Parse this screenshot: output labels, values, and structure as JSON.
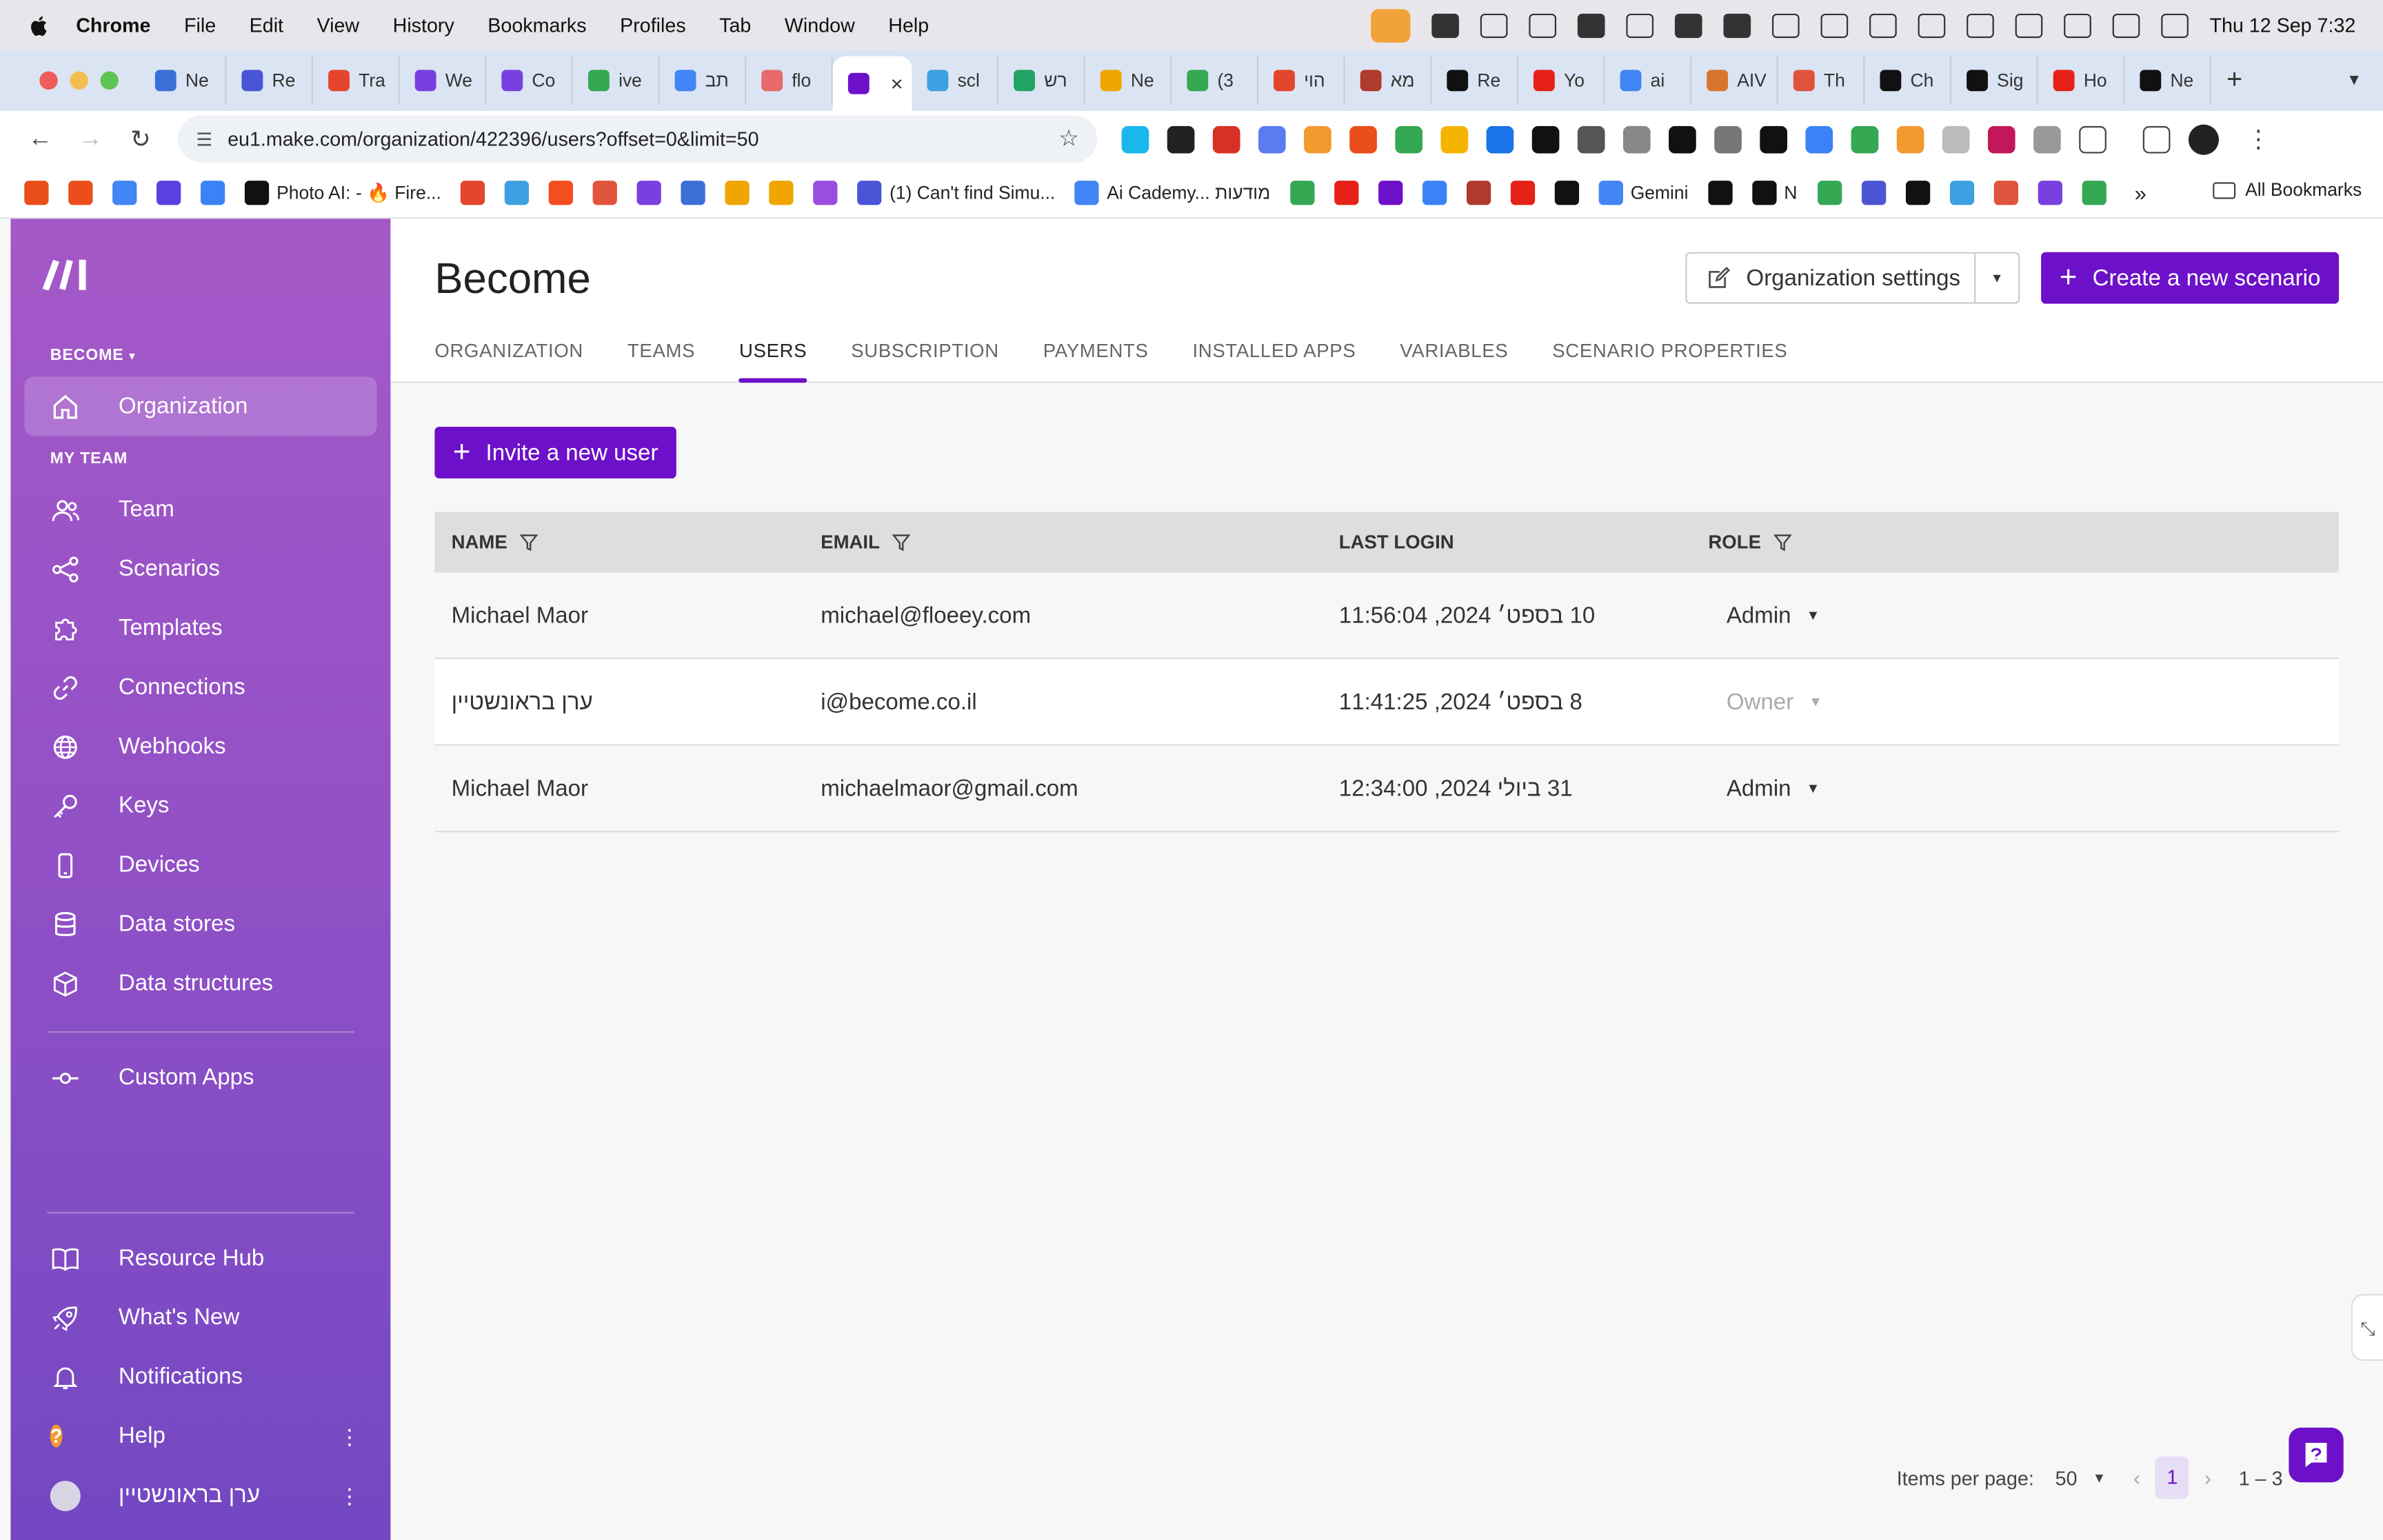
{
  "os_menubar": {
    "app": "Chrome",
    "items": [
      "File",
      "Edit",
      "View",
      "History",
      "Bookmarks",
      "Profiles",
      "Tab",
      "Window",
      "Help"
    ],
    "clock": "Thu 12 Sep  7:32"
  },
  "browser": {
    "tabs": [
      {
        "label": "Ne",
        "color": "#3b6fd8"
      },
      {
        "label": "Re",
        "color": "#4a55d6"
      },
      {
        "label": "Tra",
        "color": "#e3462c"
      },
      {
        "label": "We",
        "color": "#7a3fe0"
      },
      {
        "label": "Co",
        "color": "#7a3fe0"
      },
      {
        "label": "ive",
        "color": "#34a853"
      },
      {
        "label": "תב",
        "color": "#4285f4"
      },
      {
        "label": "flo",
        "color": "#e86a6a"
      },
      {
        "label": "",
        "color": "#6d10c9",
        "active": true
      },
      {
        "label": "scl",
        "color": "#3ea0e0"
      },
      {
        "label": "רש",
        "color": "#21a464"
      },
      {
        "label": "Ne",
        "color": "#f0a500"
      },
      {
        "label": "(3",
        "color": "#34a853"
      },
      {
        "label": "הוי",
        "color": "#e3462c"
      },
      {
        "label": "מא",
        "color": "#b03a2e"
      },
      {
        "label": "Re",
        "color": "#111111"
      },
      {
        "label": "Yo",
        "color": "#e62117"
      },
      {
        "label": "ai",
        "color": "#4285f4"
      },
      {
        "label": "AIV",
        "color": "#d9752b"
      },
      {
        "label": "Th",
        "color": "#e0533d"
      },
      {
        "label": "Ch",
        "color": "#111111"
      },
      {
        "label": "Sig",
        "color": "#111111"
      },
      {
        "label": "Ho",
        "color": "#e62117"
      },
      {
        "label": "Ne",
        "color": "#111111"
      }
    ],
    "url": "eu1.make.com/organization/422396/users?offset=0&limit=50",
    "bookmarks": [
      {
        "label": "",
        "color": "#e94e1b"
      },
      {
        "label": "",
        "color": "#e94e1b"
      },
      {
        "label": "",
        "color": "#4285f4"
      },
      {
        "label": "",
        "color": "#5b3fe0"
      },
      {
        "label": "",
        "color": "#3b82f6"
      },
      {
        "label": "Photo AI: - 🔥 Fire...",
        "color": "#111111"
      },
      {
        "label": "",
        "color": "#e3462c"
      },
      {
        "label": "",
        "color": "#3ea0e0"
      },
      {
        "label": "",
        "color": "#f24e1e"
      },
      {
        "label": "",
        "color": "#e0533d"
      },
      {
        "label": "",
        "color": "#7a3fe0"
      },
      {
        "label": "",
        "color": "#3b6fd8"
      },
      {
        "label": "",
        "color": "#f0a500"
      },
      {
        "label": "",
        "color": "#f0a500"
      },
      {
        "label": "",
        "color": "#9b4de0"
      },
      {
        "label": "(1) Can't find Simu...",
        "color": "#4a55d6"
      },
      {
        "label": "Ai Cademy... מודעות",
        "color": "#4285f4"
      },
      {
        "label": "",
        "color": "#34a853"
      },
      {
        "label": "",
        "color": "#e62117"
      },
      {
        "label": "",
        "color": "#6d10c9"
      },
      {
        "label": "",
        "color": "#3b82f6"
      },
      {
        "label": "",
        "color": "#b03a2e"
      },
      {
        "label": "",
        "color": "#e62117"
      },
      {
        "label": "",
        "color": "#111111"
      },
      {
        "label": "Gemini",
        "color": "#4285f4"
      },
      {
        "label": "",
        "color": "#111111"
      },
      {
        "label": "N",
        "color": "#111111"
      },
      {
        "label": "",
        "color": "#34a853"
      },
      {
        "label": "",
        "color": "#4a55d6"
      },
      {
        "label": "",
        "color": "#111111"
      },
      {
        "label": "",
        "color": "#3ea0e0"
      },
      {
        "label": "",
        "color": "#e0533d"
      },
      {
        "label": "",
        "color": "#7a3fe0"
      },
      {
        "label": "",
        "color": "#34a853"
      }
    ],
    "all_bookmarks": "All Bookmarks"
  },
  "sidebar": {
    "org_switcher": "BECOME",
    "primary": {
      "label": "Organization",
      "icon": "home-icon"
    },
    "section_label": "MY TEAM",
    "items": [
      {
        "label": "Team",
        "icon": "users-icon"
      },
      {
        "label": "Scenarios",
        "icon": "share-icon"
      },
      {
        "label": "Templates",
        "icon": "puzzle-icon"
      },
      {
        "label": "Connections",
        "icon": "link-icon"
      },
      {
        "label": "Webhooks",
        "icon": "globe-icon"
      },
      {
        "label": "Keys",
        "icon": "key-icon"
      },
      {
        "label": "Devices",
        "icon": "device-icon"
      },
      {
        "label": "Data stores",
        "icon": "database-icon"
      },
      {
        "label": "Data structures",
        "icon": "cube-icon"
      }
    ],
    "custom_apps": "Custom Apps",
    "bottom": [
      {
        "label": "Resource Hub",
        "icon": "book-icon"
      },
      {
        "label": "What's New",
        "icon": "rocket-icon"
      },
      {
        "label": "Notifications",
        "icon": "bell-icon"
      },
      {
        "label": "Help",
        "icon": "help-icon"
      }
    ],
    "user_name": "ערן בראונשטיין"
  },
  "header": {
    "title": "Become",
    "org_settings": "Organization settings",
    "create_scenario": "Create a new scenario",
    "tabs": [
      {
        "label": "ORGANIZATION"
      },
      {
        "label": "TEAMS"
      },
      {
        "label": "USERS",
        "active": true
      },
      {
        "label": "SUBSCRIPTION"
      },
      {
        "label": "PAYMENTS"
      },
      {
        "label": "INSTALLED APPS"
      },
      {
        "label": "VARIABLES"
      },
      {
        "label": "SCENARIO PROPERTIES"
      }
    ]
  },
  "users": {
    "invite_button": "Invite a new user",
    "columns": {
      "name": "NAME",
      "email": "EMAIL",
      "last_login": "LAST LOGIN",
      "role": "ROLE"
    },
    "rows": [
      {
        "name": "Michael Maor",
        "email": "michael@floeey.com",
        "last_login": "10 בספט׳ 2024, 11:56:04",
        "role": "Admin",
        "role_editable": true
      },
      {
        "name": "ערן בראונשטיין",
        "email": "i@become.co.il",
        "last_login": "8 בספט׳ 2024, 11:41:25",
        "role": "Owner",
        "role_editable": false
      },
      {
        "name": "Michael Maor",
        "email": "michaelmaor@gmail.com",
        "last_login": "31 ביולי 2024, 12:34:00",
        "role": "Admin",
        "role_editable": true
      }
    ],
    "pagination": {
      "items_per_page_label": "Items per page:",
      "per_page": "50",
      "current_page": "1",
      "range": "1 – 3"
    }
  },
  "colors": {
    "accent": "#6d10c9",
    "sidebar_top": "#a559c8",
    "sidebar_bottom": "#7348c2"
  }
}
